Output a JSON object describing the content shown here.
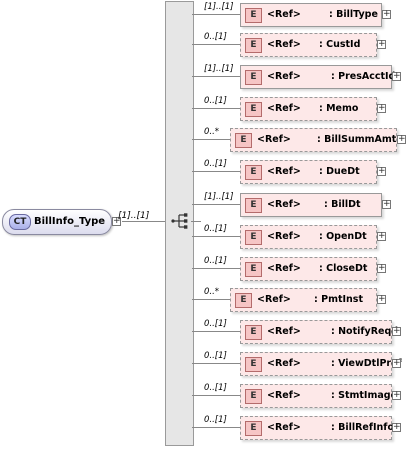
{
  "root": {
    "badge": "CT",
    "name": "BillInfo_Type",
    "cardinality": "[1]..[1]"
  },
  "items": [
    {
      "card": "[1]..[1]",
      "ref": "<Ref>",
      "name": ": BillType",
      "optional": false
    },
    {
      "card": "0..[1]",
      "ref": "<Ref>",
      "name": ": CustId",
      "optional": true
    },
    {
      "card": "[1]..[1]",
      "ref": "<Ref>",
      "name": ": PresAcctId",
      "optional": false
    },
    {
      "card": "0..[1]",
      "ref": "<Ref>",
      "name": ": Memo",
      "optional": true
    },
    {
      "card": "0..*",
      "ref": "<Ref>",
      "name": ": BillSummAmt",
      "optional": true
    },
    {
      "card": "0..[1]",
      "ref": "<Ref>",
      "name": ": DueDt",
      "optional": true
    },
    {
      "card": "[1]..[1]",
      "ref": "<Ref>",
      "name": ": BillDt",
      "optional": false
    },
    {
      "card": "0..[1]",
      "ref": "<Ref>",
      "name": ": OpenDt",
      "optional": true
    },
    {
      "card": "0..[1]",
      "ref": "<Ref>",
      "name": ": CloseDt",
      "optional": true
    },
    {
      "card": "0..*",
      "ref": "<Ref>",
      "name": ": PmtInst",
      "optional": true
    },
    {
      "card": "0..[1]",
      "ref": "<Ref>",
      "name": ": NotifyReqd",
      "optional": true
    },
    {
      "card": "0..[1]",
      "ref": "<Ref>",
      "name": ": ViewDtlPref",
      "optional": true
    },
    {
      "card": "0..[1]",
      "ref": "<Ref>",
      "name": ": StmtImage",
      "optional": true
    },
    {
      "card": "0..[1]",
      "ref": "<Ref>",
      "name": ": BillRefInfo",
      "optional": true
    }
  ],
  "badges": {
    "element": "E",
    "expand": "+"
  }
}
